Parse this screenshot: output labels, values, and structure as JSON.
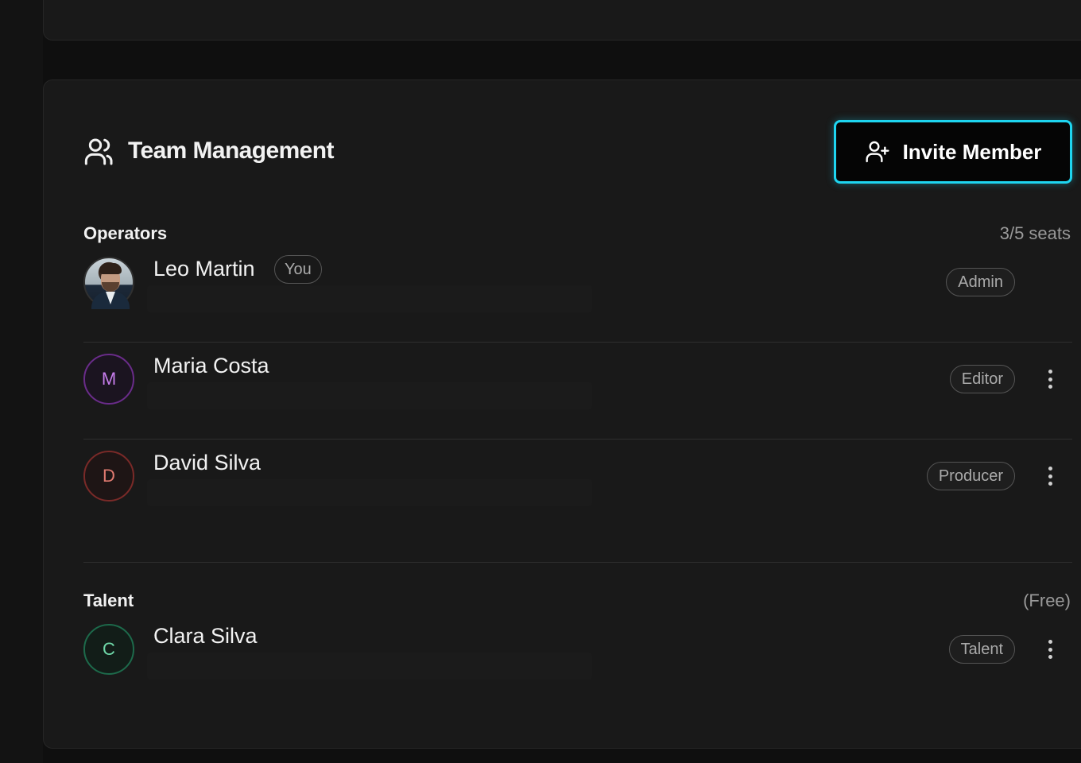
{
  "team": {
    "title": "Team Management",
    "invite_label": "Invite Member"
  },
  "operators": {
    "title": "Operators",
    "seats": "3/5 seats",
    "members": [
      {
        "name": "Leo Martin",
        "badge": "You",
        "role": "Admin",
        "initial": ""
      },
      {
        "name": "Maria Costa",
        "role": "Editor",
        "initial": "M"
      },
      {
        "name": "David Silva",
        "role": "Producer",
        "initial": "D"
      }
    ]
  },
  "talent": {
    "title": "Talent",
    "meta": "(Free)",
    "members": [
      {
        "name": "Clara Silva",
        "role": "Talent",
        "initial": "C"
      }
    ]
  },
  "colors": {
    "accent": "#1ed5f0",
    "background": "#191919",
    "maria_avatar": "#c77dec",
    "david_avatar": "#e07a70",
    "clara_avatar": "#6fd8a8"
  },
  "icons": {
    "team": "users-icon",
    "invite": "user-plus-icon",
    "row_menu": "more-vertical-icon"
  }
}
